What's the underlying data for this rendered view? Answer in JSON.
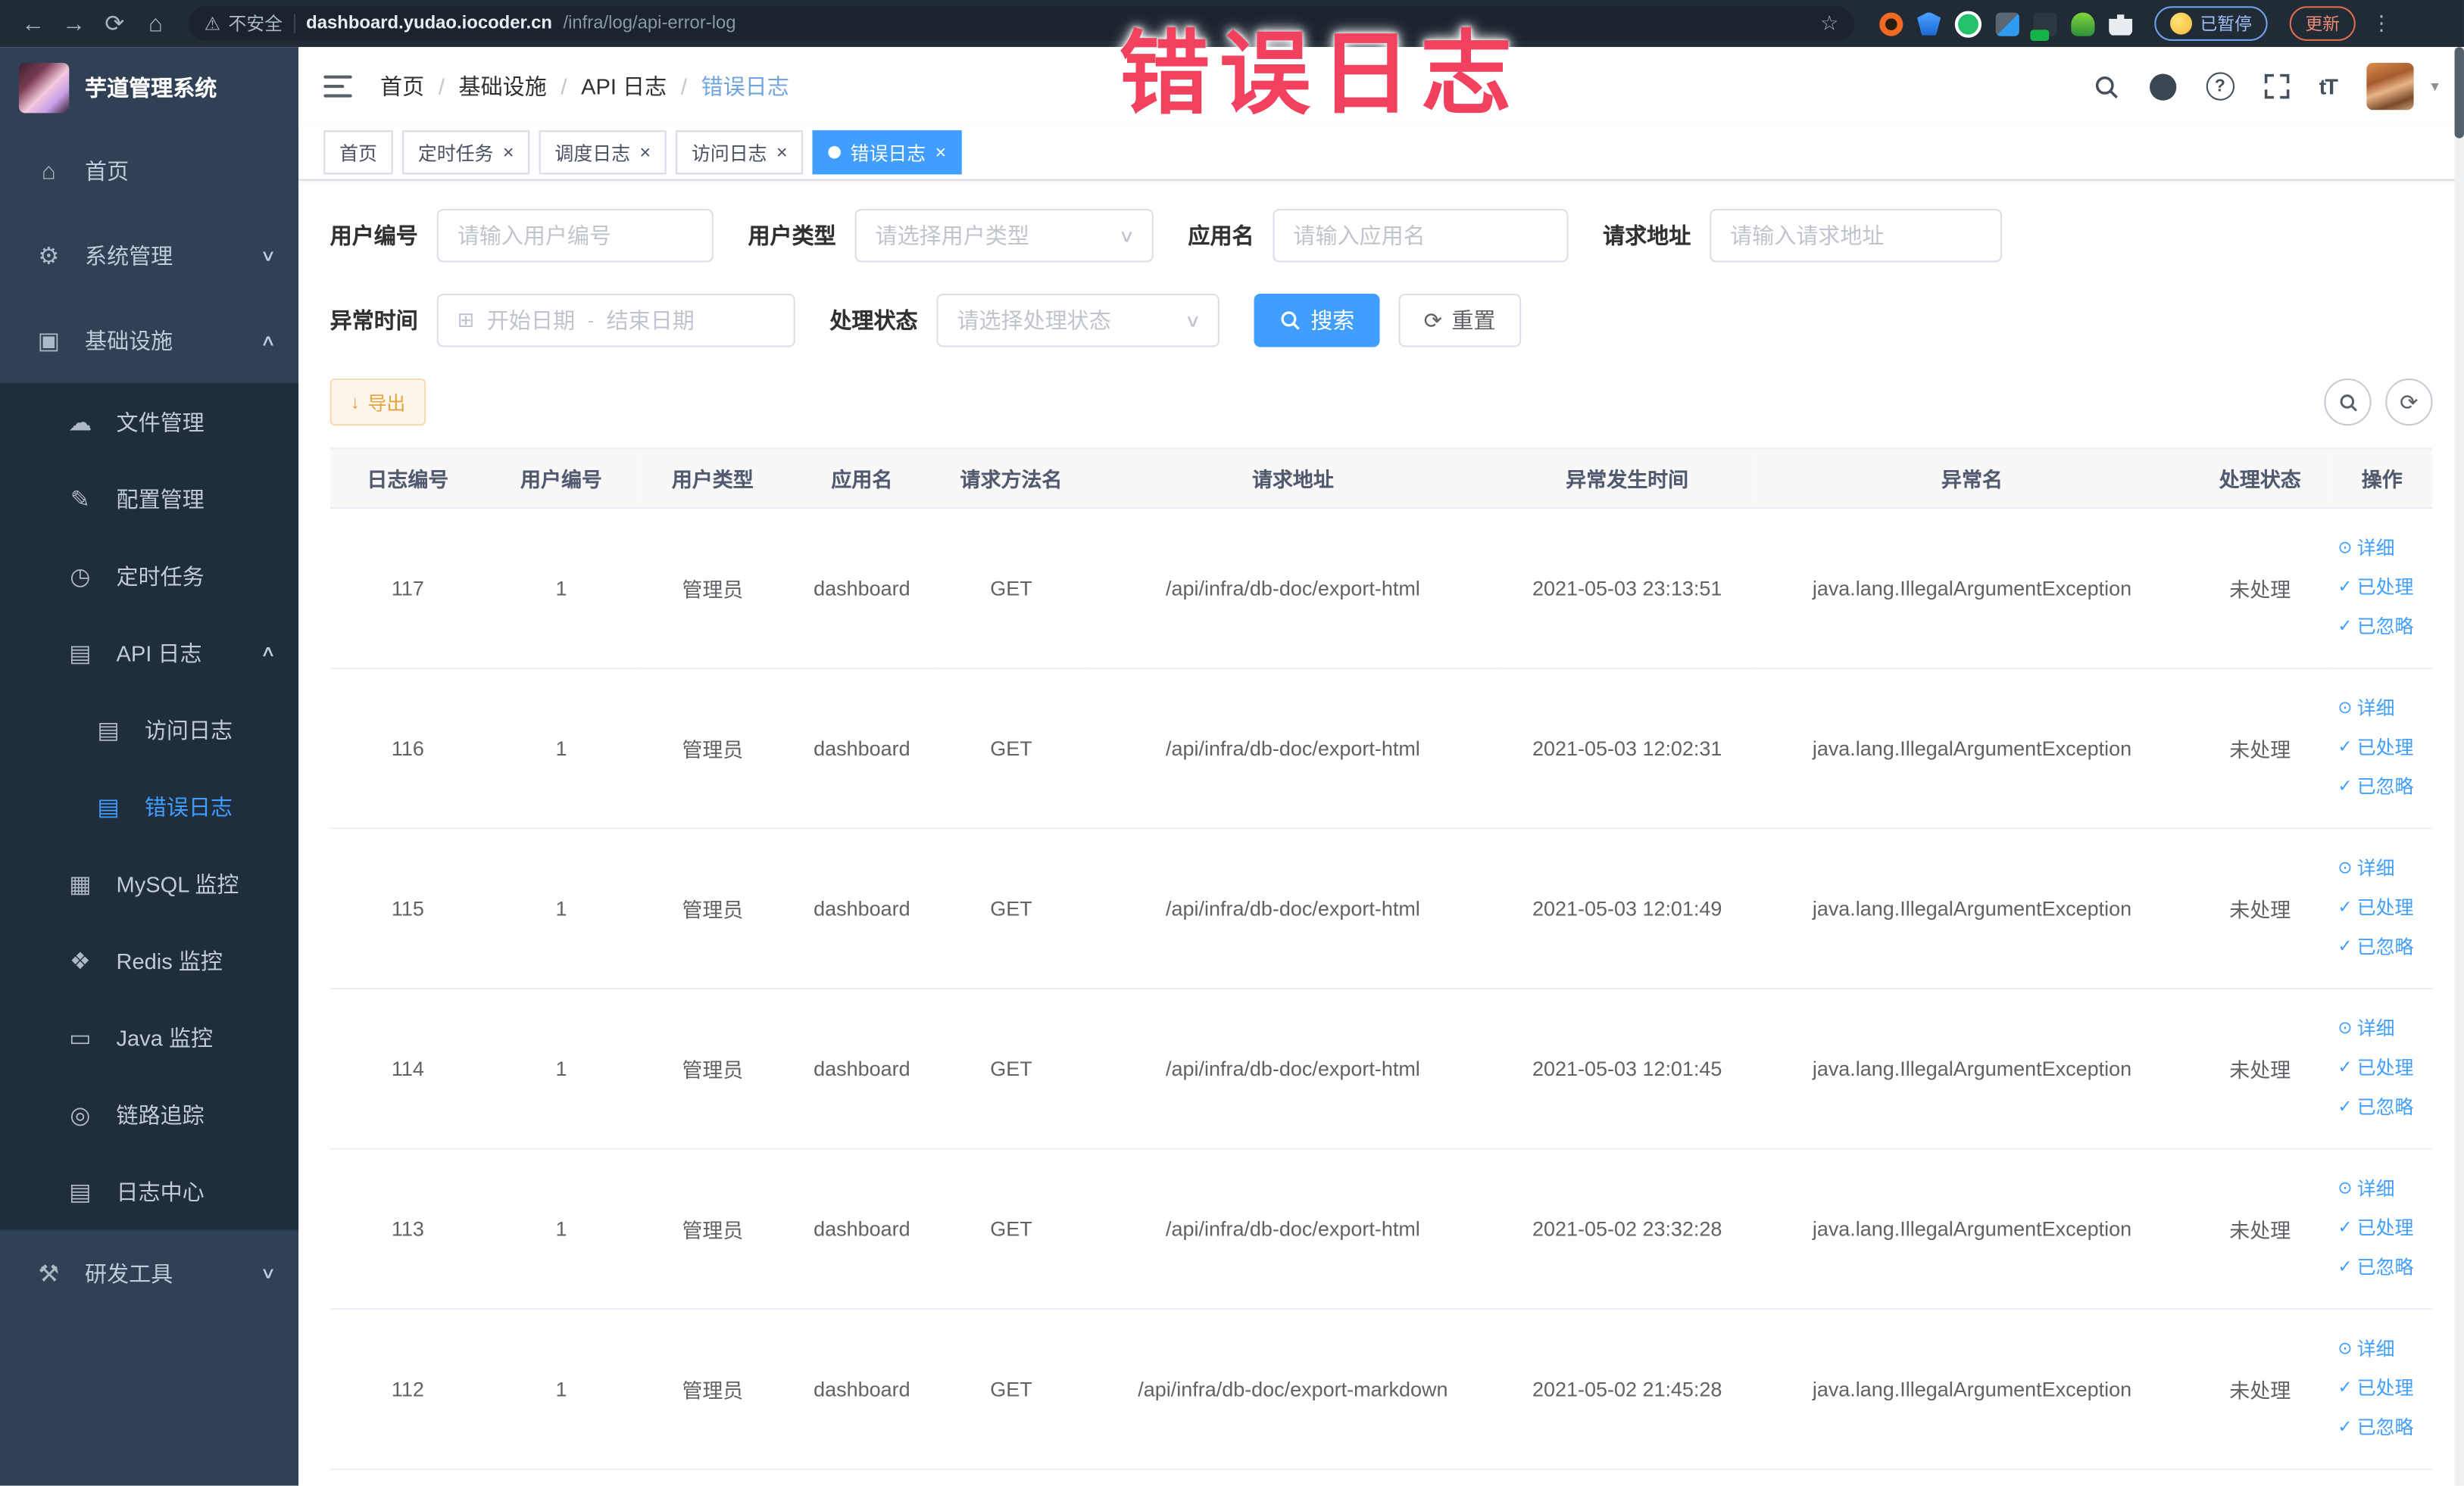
{
  "browser": {
    "security_warning": "不安全",
    "url_host": "dashboard.yudao.iocoder.cn",
    "url_path": "/infra/log/api-error-log",
    "paused_badge": "已暂停",
    "update_button": "更新"
  },
  "icons": {
    "back": "←",
    "forward": "→",
    "reload": "⟳",
    "home": "⌂",
    "warning": "⚠",
    "star": "☆",
    "dots": "⋮",
    "help": "?",
    "font_size": "tT",
    "caret": "▾",
    "menu_home": "⌂",
    "gear": "⚙",
    "infra": "▣",
    "cloud": "☁",
    "edit": "✎",
    "clock": "◷",
    "doc": "▤",
    "grid": "▦",
    "redis": "❖",
    "monitor": "▭",
    "eye": "◎",
    "toolbox": "⚒",
    "chevron_down": "∨",
    "chevron_up": "∧",
    "calendar": "⊞",
    "select_caret": "∨",
    "close": "×",
    "check": "✓",
    "eye_small": "⊙",
    "download": "↓",
    "refresh": "⟳"
  },
  "annotation": {
    "text": "错误日志"
  },
  "sidebar": {
    "title": "芋道管理系统",
    "items": [
      {
        "label": "首页"
      },
      {
        "label": "系统管理"
      },
      {
        "label": "基础设施"
      },
      {
        "label": "文件管理"
      },
      {
        "label": "配置管理"
      },
      {
        "label": "定时任务"
      },
      {
        "label": "API 日志"
      },
      {
        "label": "访问日志"
      },
      {
        "label": "错误日志"
      },
      {
        "label": "MySQL 监控"
      },
      {
        "label": "Redis 监控"
      },
      {
        "label": "Java 监控"
      },
      {
        "label": "链路追踪"
      },
      {
        "label": "日志中心"
      },
      {
        "label": "研发工具"
      }
    ]
  },
  "header": {
    "breadcrumb": [
      "首页",
      "基础设施",
      "API 日志",
      "错误日志"
    ],
    "separator": "/"
  },
  "tabs": [
    {
      "label": "首页"
    },
    {
      "label": "定时任务"
    },
    {
      "label": "调度日志"
    },
    {
      "label": "访问日志"
    },
    {
      "label": "错误日志"
    }
  ],
  "filters": {
    "user_id": {
      "label": "用户编号",
      "placeholder": "请输入用户编号"
    },
    "user_type": {
      "label": "用户类型",
      "placeholder": "请选择用户类型"
    },
    "app_name": {
      "label": "应用名",
      "placeholder": "请输入应用名"
    },
    "request_url": {
      "label": "请求地址",
      "placeholder": "请输入请求地址"
    },
    "exception_time": {
      "label": "异常时间",
      "start_placeholder": "开始日期",
      "separator": "-",
      "end_placeholder": "结束日期"
    },
    "process_status": {
      "label": "处理状态",
      "placeholder": "请选择处理状态"
    },
    "search_label": "搜索",
    "reset_label": "重置"
  },
  "toolbar": {
    "export_label": "导出"
  },
  "table": {
    "columns": [
      "日志编号",
      "用户编号",
      "用户类型",
      "应用名",
      "请求方法名",
      "请求地址",
      "异常发生时间",
      "异常名",
      "处理状态",
      "操作"
    ],
    "actions": [
      "详细",
      "已处理",
      "已忽略"
    ],
    "rows": [
      {
        "log_id": "117",
        "user_id": "1",
        "user_type": "管理员",
        "app_name": "dashboard",
        "method": "GET",
        "request_url": "/api/infra/db-doc/export-html",
        "time": "2021-05-03 23:13:51",
        "exception_name": "java.lang.IllegalArgumentException",
        "status": "未处理"
      },
      {
        "log_id": "116",
        "user_id": "1",
        "user_type": "管理员",
        "app_name": "dashboard",
        "method": "GET",
        "request_url": "/api/infra/db-doc/export-html",
        "time": "2021-05-03 12:02:31",
        "exception_name": "java.lang.IllegalArgumentException",
        "status": "未处理"
      },
      {
        "log_id": "115",
        "user_id": "1",
        "user_type": "管理员",
        "app_name": "dashboard",
        "method": "GET",
        "request_url": "/api/infra/db-doc/export-html",
        "time": "2021-05-03 12:01:49",
        "exception_name": "java.lang.IllegalArgumentException",
        "status": "未处理"
      },
      {
        "log_id": "114",
        "user_id": "1",
        "user_type": "管理员",
        "app_name": "dashboard",
        "method": "GET",
        "request_url": "/api/infra/db-doc/export-html",
        "time": "2021-05-03 12:01:45",
        "exception_name": "java.lang.IllegalArgumentException",
        "status": "未处理"
      },
      {
        "log_id": "113",
        "user_id": "1",
        "user_type": "管理员",
        "app_name": "dashboard",
        "method": "GET",
        "request_url": "/api/infra/db-doc/export-html",
        "time": "2021-05-02 23:32:28",
        "exception_name": "java.lang.IllegalArgumentException",
        "status": "未处理"
      },
      {
        "log_id": "112",
        "user_id": "1",
        "user_type": "管理员",
        "app_name": "dashboard",
        "method": "GET",
        "request_url": "/api/infra/db-doc/export-markdown",
        "time": "2021-05-02 21:45:28",
        "exception_name": "java.lang.IllegalArgumentException",
        "status": "未处理"
      }
    ]
  }
}
